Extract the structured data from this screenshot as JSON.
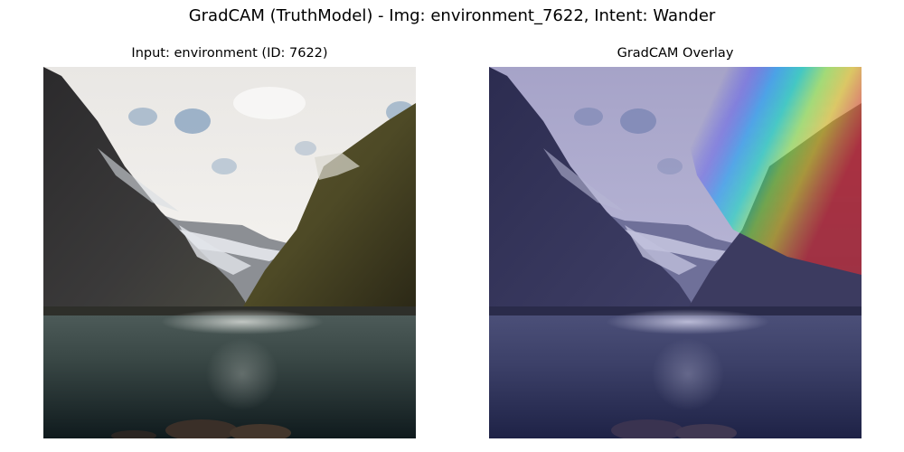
{
  "figure": {
    "suptitle": "GradCAM (TruthModel) - Img: environment_7622, Intent: Wander"
  },
  "panels": [
    {
      "title": "Input: environment (ID: 7622)",
      "kind": "input-photo"
    },
    {
      "title": "GradCAM Overlay",
      "kind": "gradcam-overlay",
      "colormap": "jet"
    }
  ]
}
